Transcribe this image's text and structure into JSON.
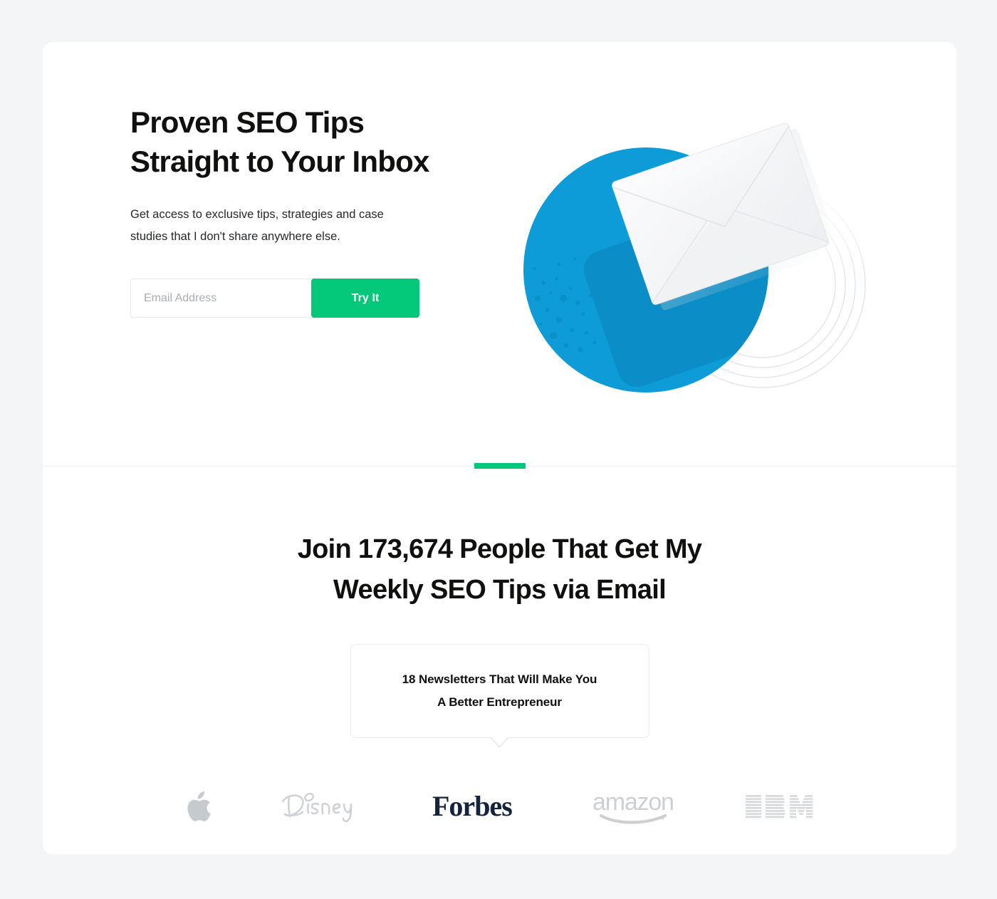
{
  "colors": {
    "page_background": "#f4f5f7",
    "card_background": "#ffffff",
    "accent_green": "#03c87a",
    "illustration_blue": "#0e9cd8",
    "illustration_blue_dark": "#0b8dc6",
    "envelope_white": "#f3f4f6",
    "text_dark": "#10100f",
    "text_body": "#25282c",
    "placeholder_grey": "#a9aeb4",
    "border_grey": "#e7e9ec",
    "logo_grey": "#cbcdd1",
    "forbes_navy": "#16233f"
  },
  "hero": {
    "title": "Proven SEO Tips\nStraight to Your Inbox",
    "subtitle": "Get access to exclusive tips, strategies and case\nstudies that I don't share anywhere else.",
    "form": {
      "email_placeholder": "Email Address",
      "email_value": "",
      "submit_label": "Try It"
    },
    "illustration": {
      "name": "envelope-in-circle-illustration",
      "elements": [
        "blue-circle",
        "envelope",
        "concentric-rings",
        "dot-texture"
      ]
    }
  },
  "divider": {
    "accent_name": "green-accent-bar"
  },
  "proof": {
    "title": "Join 173,674 People That Get My\nWeekly SEO Tips via Email",
    "subscriber_count": "173,674",
    "bubble": {
      "text": "18 Newsletters That Will Make You\nA Better Entrepreneur",
      "newsletter_count": "18"
    },
    "logos": [
      {
        "name": "apple-logo",
        "label": "Apple"
      },
      {
        "name": "disney-logo",
        "label": "Disney"
      },
      {
        "name": "forbes-logo",
        "label": "Forbes"
      },
      {
        "name": "amazon-logo",
        "label": "amazon"
      },
      {
        "name": "ibm-logo",
        "label": "IBM"
      }
    ]
  }
}
